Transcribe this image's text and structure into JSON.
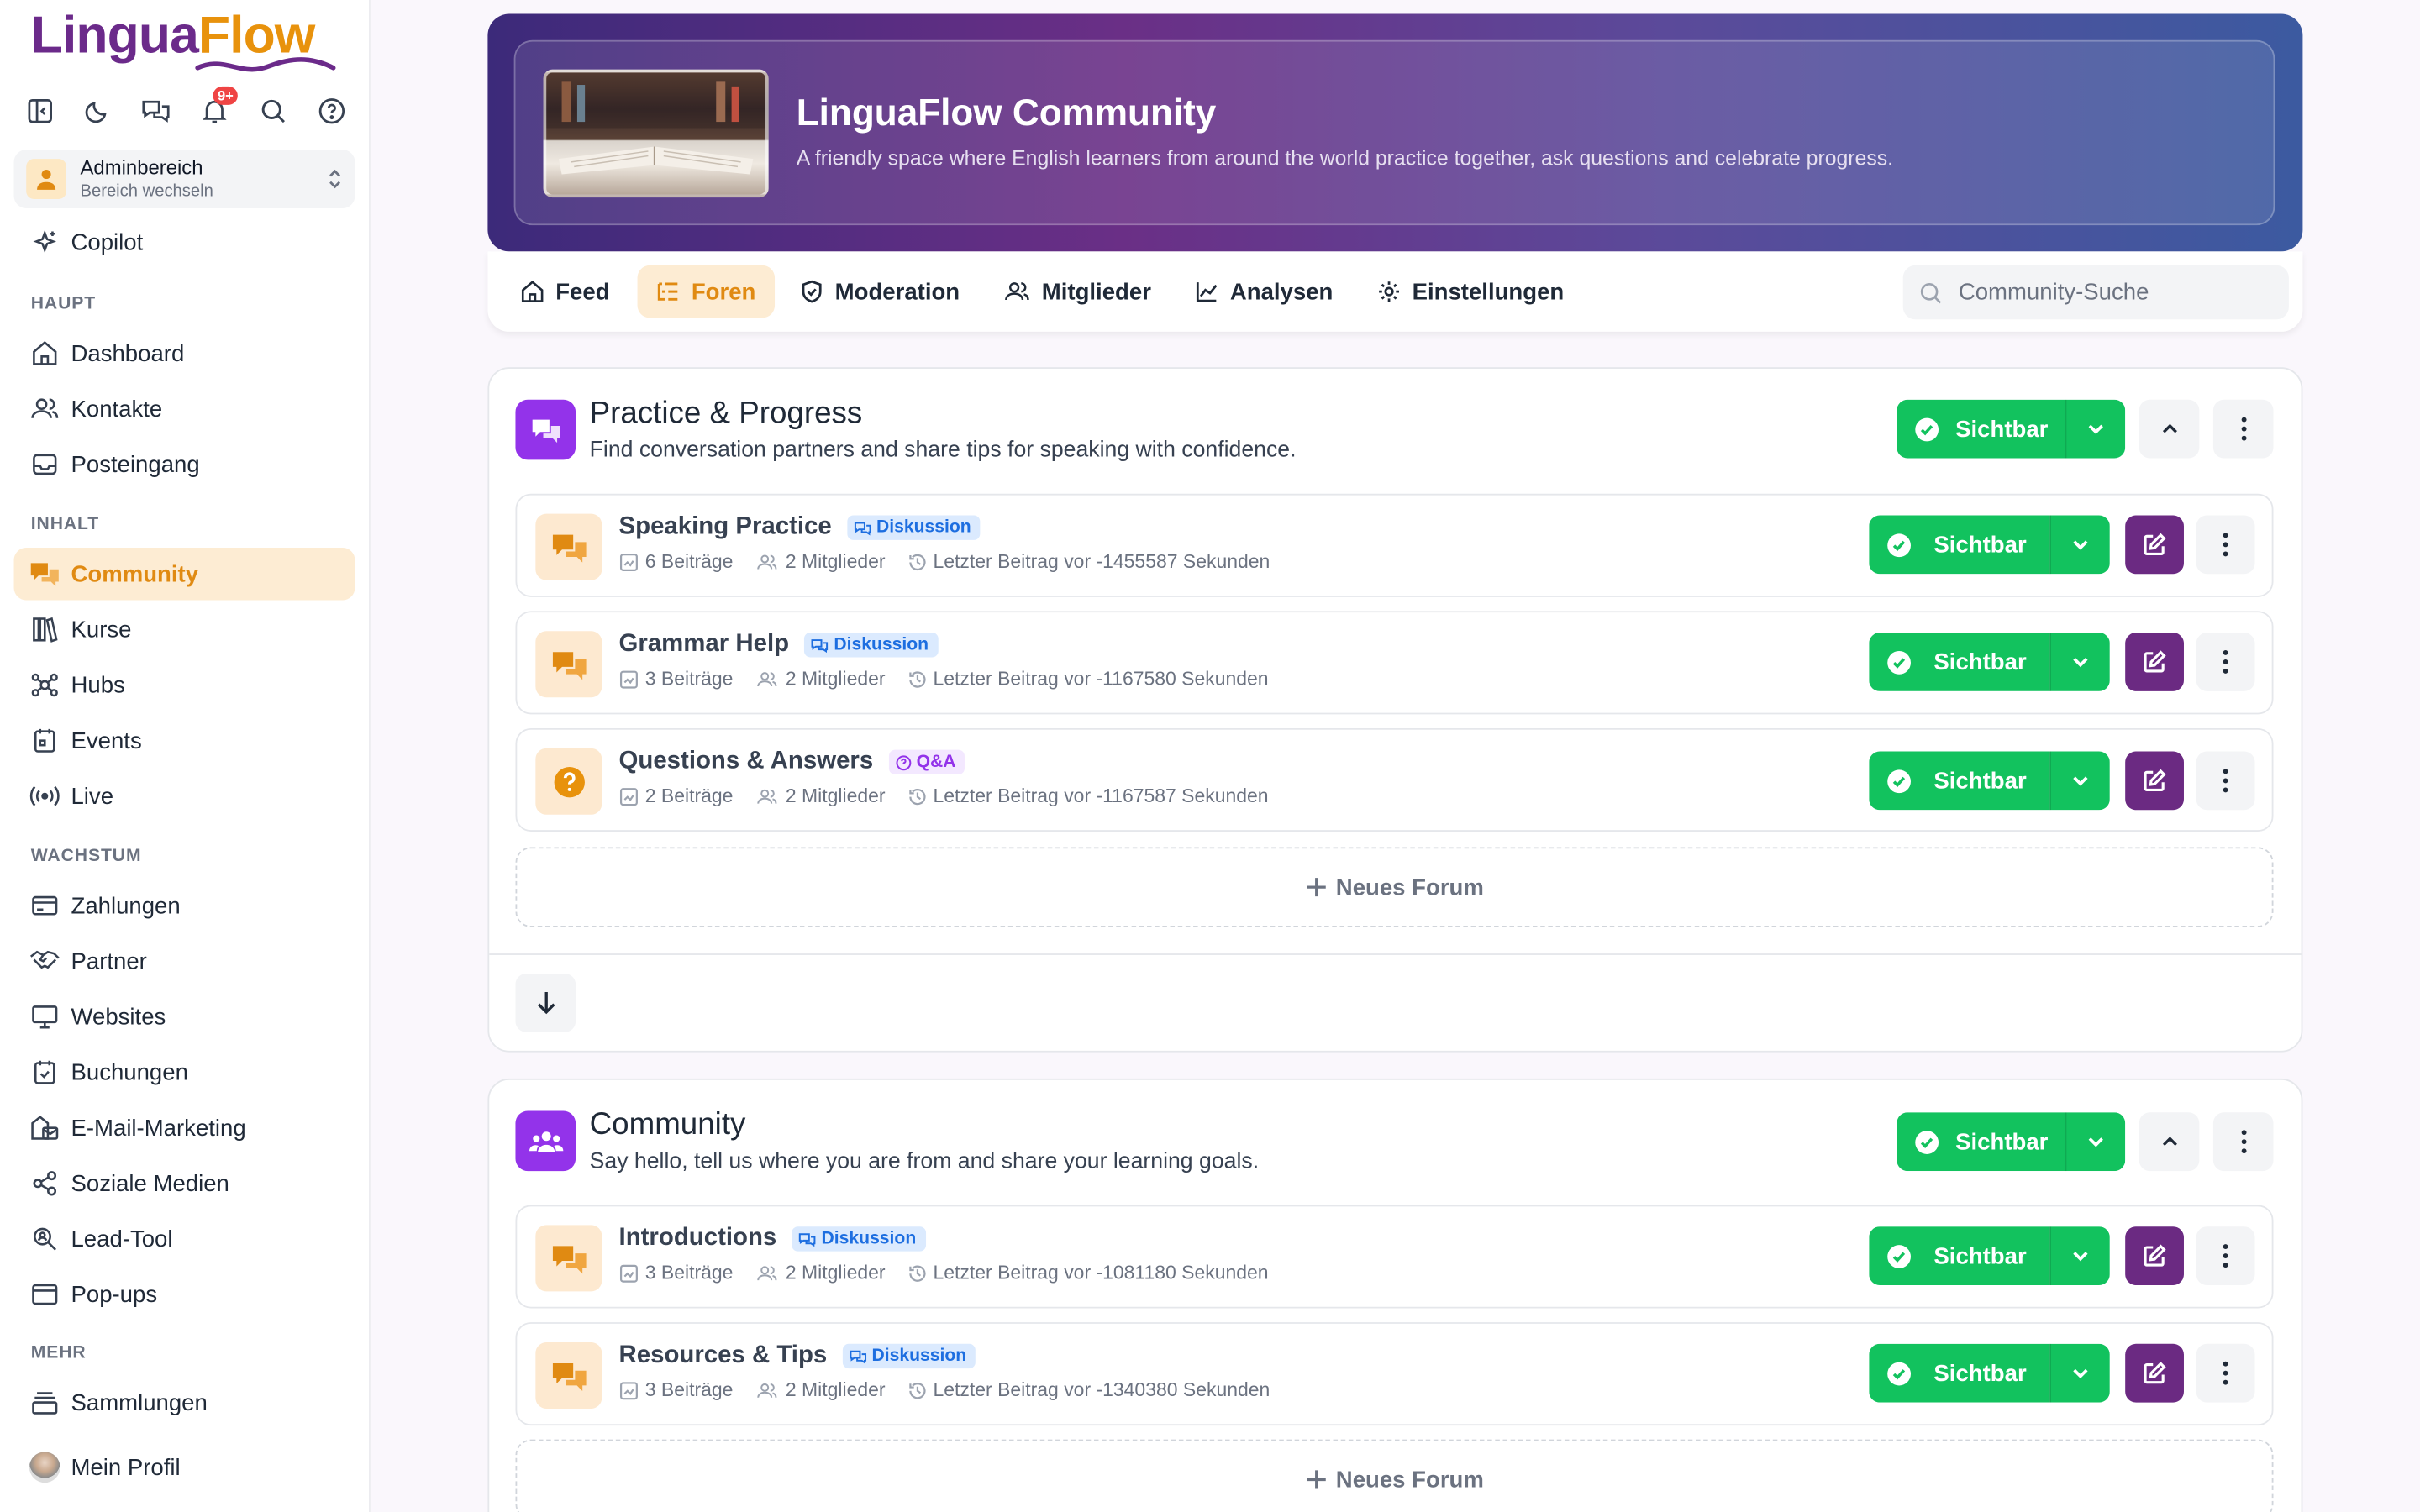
{
  "app": {
    "logo_part1": "Lingua",
    "logo_part2": "Flow",
    "notification_count": "9+"
  },
  "switcher": {
    "title": "Adminbereich",
    "subtitle": "Bereich wechseln"
  },
  "sidebar": {
    "copilot": "Copilot",
    "sections": {
      "main": "HAUPT",
      "content": "INHALT",
      "growth": "WACHSTUM",
      "more": "MEHR"
    },
    "items": {
      "dashboard": "Dashboard",
      "contacts": "Kontakte",
      "inbox": "Posteingang",
      "community": "Community",
      "courses": "Kurse",
      "hubs": "Hubs",
      "events": "Events",
      "live": "Live",
      "payments": "Zahlungen",
      "partners": "Partner",
      "websites": "Websites",
      "bookings": "Buchungen",
      "email": "E-Mail-Marketing",
      "social": "Soziale Medien",
      "lead": "Lead-Tool",
      "popups": "Pop-ups",
      "collections": "Sammlungen",
      "profile": "Mein Profil"
    }
  },
  "header": {
    "title": "LinguaFlow Community",
    "subtitle": "A friendly space where English learners from around the world practice together, ask questions and celebrate progress."
  },
  "tabs": {
    "feed": "Feed",
    "forums": "Foren",
    "moderation": "Moderation",
    "members": "Mitglieder",
    "analytics": "Analysen",
    "settings": "Einstellungen"
  },
  "search": {
    "placeholder": "Community-Suche"
  },
  "visibility_label": "Sichtbar",
  "new_forum_label": "Neues Forum",
  "sections": [
    {
      "title": "Practice & Progress",
      "description": "Find conversation partners and share tips for speaking with confidence.",
      "forums": [
        {
          "title": "Speaking Practice",
          "badge": "Diskussion",
          "posts": "6 Beiträge",
          "members": "2 Mitglieder",
          "last": "Letzter Beitrag vor -1455587 Sekunden"
        },
        {
          "title": "Grammar Help",
          "badge": "Diskussion",
          "posts": "3 Beiträge",
          "members": "2 Mitglieder",
          "last": "Letzter Beitrag vor -1167580 Sekunden"
        },
        {
          "title": "Questions & Answers",
          "badge": "Q&A",
          "posts": "2 Beiträge",
          "members": "2 Mitglieder",
          "last": "Letzter Beitrag vor -1167587 Sekunden"
        }
      ]
    },
    {
      "title": "Community",
      "description": "Say hello, tell us where you are from and share your learning goals.",
      "forums": [
        {
          "title": "Introductions",
          "badge": "Diskussion",
          "posts": "3 Beiträge",
          "members": "2 Mitglieder",
          "last": "Letzter Beitrag vor -1081180 Sekunden"
        },
        {
          "title": "Resources & Tips",
          "badge": "Diskussion",
          "posts": "3 Beiträge",
          "members": "2 Mitglieder",
          "last": "Letzter Beitrag vor -1340380 Sekunden"
        }
      ]
    }
  ],
  "colors": {
    "brand_purple": "#6b2a8a",
    "brand_orange": "#e8920c",
    "visible_green": "#12c25e",
    "section_icon": "#9333ea"
  }
}
